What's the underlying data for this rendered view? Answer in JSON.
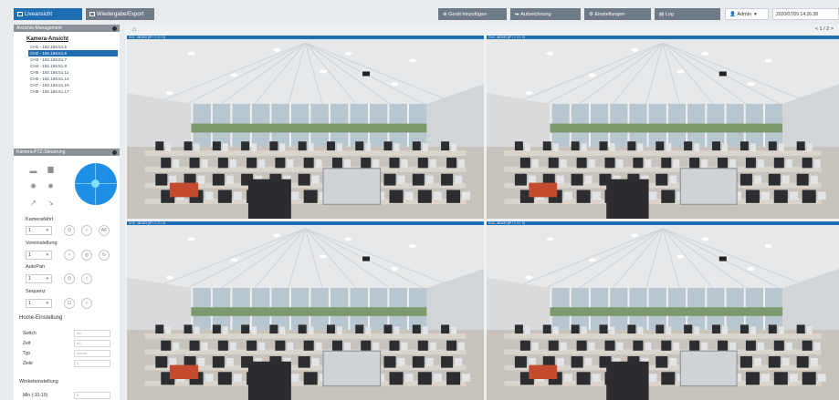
{
  "nav": {
    "live_label": "Liveansicht",
    "export_label": "Wiedergabe/Export",
    "add_device_label": "Gerät hinzufügen",
    "record_label": "Aufzeichnung",
    "settings_label": "Einstellungen",
    "log_label": "Log",
    "user_label": "Admin",
    "datetime": "2020/07/09 14:26:38"
  },
  "sidebar": {
    "panel_title": "Ansichts-Management",
    "camera_view_title": "Kamera-Ansicht",
    "cameras": [
      {
        "label": "CH1 - 192.168.51.5",
        "selected": false
      },
      {
        "label": "CH2 - 192.168.51.6",
        "selected": true
      },
      {
        "label": "CH3 - 192.168.51.7",
        "selected": false
      },
      {
        "label": "CH4 - 192.168.51.8",
        "selected": false
      },
      {
        "label": "CH5 - 192.168.51.11",
        "selected": false
      },
      {
        "label": "CH6 - 192.168.51.14",
        "selected": false
      },
      {
        "label": "CH7 - 192.168.51.15",
        "selected": false
      },
      {
        "label": "CH8 - 192.168.51.17",
        "selected": false
      }
    ],
    "ptz": {
      "title": "Kamera-PTZ-Steuerung",
      "kamerafahrt_label": "Kamerafahrt",
      "kamerafahrt_value": "1",
      "kamerafahrt_af_label": "AF",
      "voreinstellung_label": "Voreinstellung",
      "voreinstellung_value": "1",
      "autopan_label": "AutoPan",
      "autopan_value": "1",
      "sequenz_label": "Sequenz",
      "sequenz_value": "1",
      "home_title": "Home-Einstellung",
      "home_fields": [
        {
          "key": "Switch",
          "value": "An"
        },
        {
          "key": "Zeit",
          "value": "60"
        },
        {
          "key": "Typ",
          "value": "preset"
        },
        {
          "key": "Ziele",
          "value": "1"
        }
      ],
      "winkel_title": "Winkeleinstellung",
      "winkel_label": "Min (-10-10)",
      "winkel_value": "0"
    }
  },
  "video": {
    "pager": "< 1 / 2 >",
    "tiles": [
      {
        "label": "CH1 - MD191 (IP / 1 / 0 / 0)"
      },
      {
        "label": "CH2 - MD191 (IP / 1 / 0 / 0)"
      },
      {
        "label": "CH3 - MD191 (IP / 1 / 0 / 0)"
      },
      {
        "label": "CH4 - MD191 (IP / 1 / 0 / 0)"
      }
    ]
  },
  "colors": {
    "accent": "#1f6db3",
    "nav_dark": "#6e7b86",
    "joystick": "#1e8fe6"
  }
}
